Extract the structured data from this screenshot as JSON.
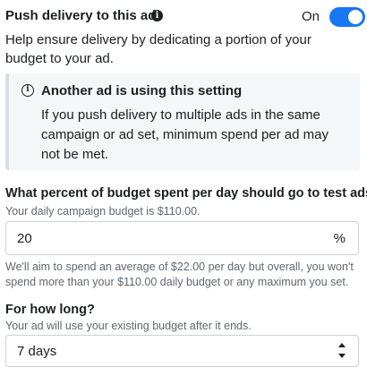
{
  "push_delivery": {
    "title": "Push delivery to this ad",
    "info_icon": "info-icon",
    "toggle_label": "On",
    "toggle_state": true,
    "accent_color": "#1877f2",
    "description": "Help ensure delivery by dedicating a portion of your budget to your ad."
  },
  "notice": {
    "icon": "info-outline-icon",
    "title": "Another ad is using this setting",
    "body": "If you push delivery to multiple ads in the same campaign or ad set, minimum spend per ad may not be met."
  },
  "budget_percent": {
    "question": "What percent of budget spent per day should go to test ads?",
    "subtext": "Your daily campaign budget is $110.00.",
    "value": "20",
    "suffix": "%",
    "help": "We'll aim to spend an average of $22.00 per day but overall, you won't spend more than your $110.00 daily budget or any maximum you set."
  },
  "duration": {
    "question": "For how long?",
    "subtext": "Your ad will use your existing budget after it ends.",
    "selected": "7 days",
    "icon": "up-down-chevron-icon"
  }
}
